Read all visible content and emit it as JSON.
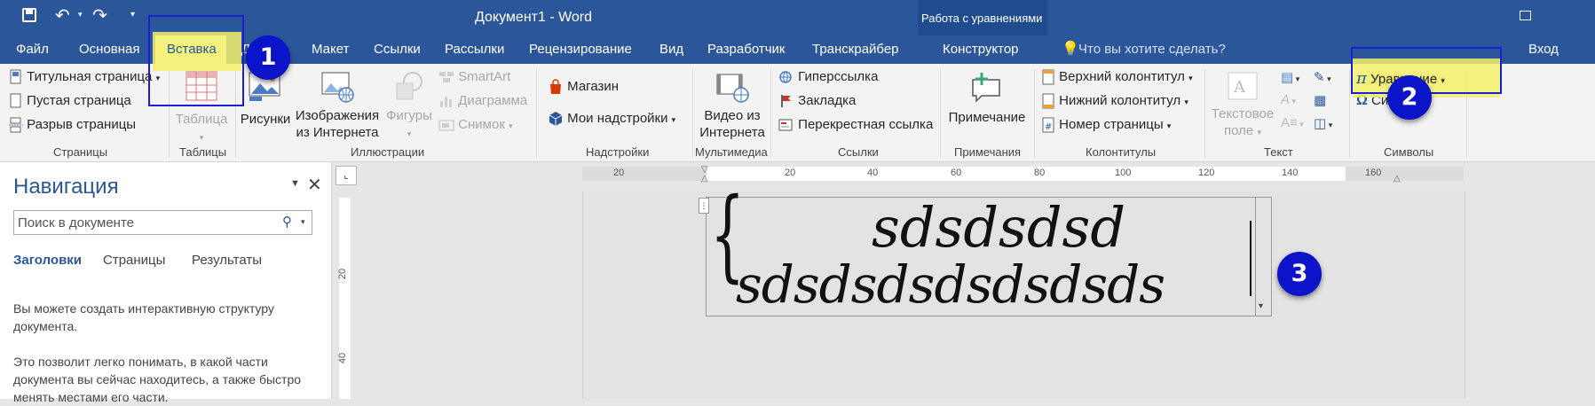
{
  "titlebar": {
    "doc_title": "Документ1 - Word",
    "context_group": "Работа с уравнениями",
    "signin": "Вход"
  },
  "tabs": [
    "Файл",
    "Основная",
    "Вставка",
    "Д",
    "Макет",
    "Ссылки",
    "Рассылки",
    "Рецензирование",
    "Вид",
    "Разработчик",
    "Транскрайбер",
    "Конструктор"
  ],
  "tellme": "Что вы хотите сделать?",
  "ribbon": {
    "pages": {
      "items": [
        "Титульная страница",
        "Пустая страница",
        "Разрыв страницы"
      ],
      "label": "Страницы"
    },
    "tables": {
      "button": "Таблица",
      "label": "Таблицы"
    },
    "illustrations": {
      "pictures": "Рисунки",
      "online_images_1": "Изображения",
      "online_images_2": "из Интернета",
      "shapes": "Фигуры",
      "smartart": "SmartArt",
      "chart": "Диаграмма",
      "screenshot": "Снимок",
      "label": "Иллюстрации"
    },
    "addins": {
      "store": "Магазин",
      "my_addins": "Мои надстройки",
      "label": "Надстройки"
    },
    "media": {
      "video_1": "Видео из",
      "video_2": "Интернета",
      "label": "Мультимедиа"
    },
    "links": {
      "hyperlink": "Гиперссылка",
      "bookmark": "Закладка",
      "crossref": "Перекрестная ссылка",
      "label": "Ссылки"
    },
    "comments": {
      "comment": "Примечание",
      "label": "Примечания"
    },
    "headerfooter": {
      "header": "Верхний колонтитул",
      "footer": "Нижний колонтитул",
      "pagenum": "Номер страницы",
      "label": "Колонтитулы"
    },
    "text": {
      "textbox_1": "Текстовое",
      "textbox_2": "поле",
      "label": "Текст"
    },
    "symbols": {
      "equation": "Уравнение",
      "symbol": "Си",
      "label": "Символы"
    }
  },
  "nav": {
    "title": "Навигация",
    "search_placeholder": "Поиск в документе",
    "tabs": [
      "Заголовки",
      "Страницы",
      "Результаты"
    ],
    "para1": "Вы можете создать интерактивную структуру документа.",
    "para2": "Это позволит легко понимать, в какой части документа вы сейчас находитесь, а также быстро менять местами его части."
  },
  "ruler": {
    "h_ticks": [
      "20",
      "20",
      "40",
      "60",
      "80",
      "100",
      "120",
      "140",
      "160"
    ],
    "v_ticks": [
      "20",
      "40"
    ]
  },
  "equation": {
    "line1": "sdsdsdsd",
    "line2": "sdsdsdsdsdsdsds"
  },
  "callouts": [
    "1",
    "2",
    "3"
  ],
  "colors": {
    "accent": "#2b579a",
    "callout": "#0b14c9",
    "highlight": "#f3f06a"
  }
}
